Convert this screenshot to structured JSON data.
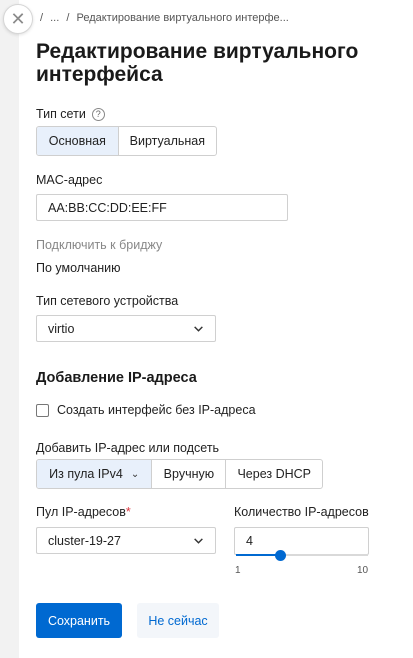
{
  "breadcrumb": {
    "items": [
      "/",
      "...",
      "/",
      "Редактирование виртуального интерфе..."
    ]
  },
  "page_title": "Редактирование виртуального интерфейса",
  "network_type": {
    "label": "Тип сети",
    "help_icon": "?",
    "options": [
      "Основная",
      "Виртуальная"
    ],
    "selected": "Основная"
  },
  "mac": {
    "label": "MAC-адрес",
    "value": "AA:BB:CC:DD:EE:FF"
  },
  "bridge": {
    "label": "Подключить к бриджу",
    "value": "По умолчанию"
  },
  "device_type": {
    "label": "Тип сетевого устройства",
    "value": "virtio"
  },
  "ip_section": {
    "title": "Добавление IP-адреса",
    "no_ip_checkbox": "Создать интерфейс без IP-адреса",
    "no_ip_checked": false,
    "add_label": "Добавить IP-адрес или подсеть",
    "add_options": [
      "Из пула IPv4",
      "Вручную",
      "Через DHCP"
    ],
    "add_selected": "Из пула IPv4",
    "pool": {
      "label": "Пул IP-адресов",
      "required_mark": "*",
      "value": "cluster-19-27"
    },
    "count": {
      "label": "Количество IP-адресов",
      "value": "4",
      "min": "1",
      "max": "10",
      "level": 0.33
    }
  },
  "actions": {
    "save": "Сохранить",
    "cancel": "Не сейчас"
  },
  "colors": {
    "accent": "#0069d1",
    "selected_segment": "#e8f0fb",
    "required": "#d9363e"
  },
  "icons": {
    "close": "close-icon",
    "help": "help-circle-icon",
    "chevron": "chevron-down-icon"
  }
}
